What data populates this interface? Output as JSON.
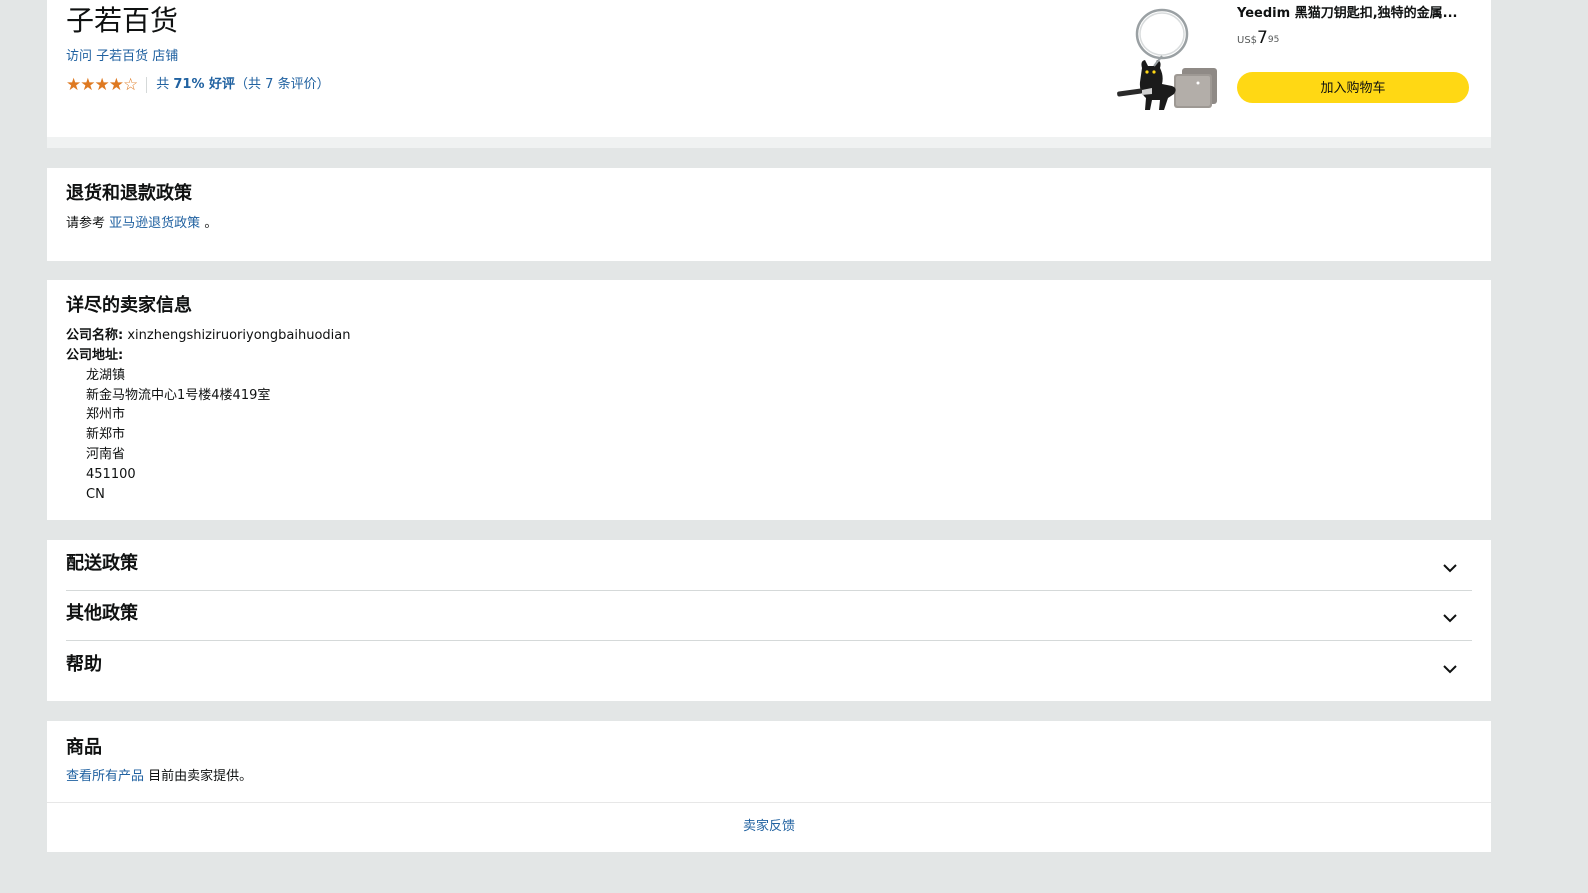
{
  "store": {
    "name": "子若百货",
    "visit_link": "访问 子若百货 店铺",
    "stars_filled": "★★★★",
    "stars_empty": "☆",
    "rating_prefix": "共",
    "rating_percent": "71% 好评",
    "rating_count": "（共 7 条评价）"
  },
  "product": {
    "title": "Yeedim 黑猫刀钥匙扣,独特的金属...",
    "currency": "US$",
    "price_whole": "7",
    "price_fraction": "95",
    "add_to_cart": "加入购物车",
    "image_icon": "cat-keychain-image"
  },
  "return_policy": {
    "title": "退货和退款政策",
    "prefix": "请参考",
    "link": "亚马逊退货政策",
    "suffix": "。"
  },
  "seller_info": {
    "title": "详尽的卖家信息",
    "company_label": "公司名称:",
    "company_value": "xinzhengshiziruoriyongbaihuodian",
    "address_label": "公司地址:",
    "address_lines": [
      "龙湖镇",
      "新金马物流中心1号楼4楼419室",
      "郑州市",
      "新郑市",
      "河南省",
      "451100",
      "CN"
    ]
  },
  "policies": [
    {
      "label": "配送政策"
    },
    {
      "label": "其他政策"
    },
    {
      "label": "帮助"
    }
  ],
  "products": {
    "title": "商品",
    "link": "查看所有产品",
    "suffix": "目前由卖家提供。",
    "feedback": "卖家反馈"
  },
  "colors": {
    "link": "#2162a1",
    "star": "#de7921",
    "button": "#ffd814",
    "background": "#e3e6e6"
  }
}
